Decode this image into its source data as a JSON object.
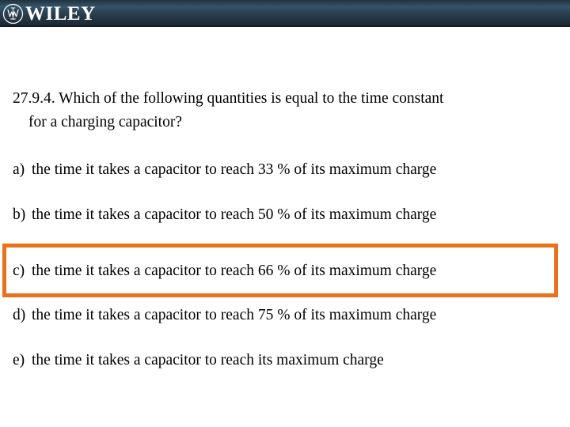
{
  "header": {
    "brand_name": "WILEY",
    "emblem_icon": "wiley-circular-monogram-icon",
    "gradient_top": "#22313e",
    "gradient_mid": "#35546a",
    "gradient_bottom": "#141c25"
  },
  "slide": {
    "question_number": "27.9.4.",
    "question_line1": "27.9.4. Which of the following quantities is equal to the time constant",
    "question_line2": "for a charging capacitor?",
    "highlight_color": "#e8711a",
    "options": [
      {
        "letter": "a)",
        "text": "the time it takes a capacitor to reach 33 % of its maximum charge",
        "highlighted": false
      },
      {
        "letter": "b)",
        "text": "the time it takes a capacitor to reach 50 % of its maximum charge",
        "highlighted": false
      },
      {
        "letter": "c)",
        "text": "the time it takes a capacitor to reach 66 % of its maximum charge",
        "highlighted": true
      },
      {
        "letter": "d)",
        "text": "the time it takes a capacitor to reach 75 % of its maximum charge",
        "highlighted": false
      },
      {
        "letter": "e)",
        "text": "the time it takes a capacitor to reach its maximum charge",
        "highlighted": false
      }
    ]
  }
}
